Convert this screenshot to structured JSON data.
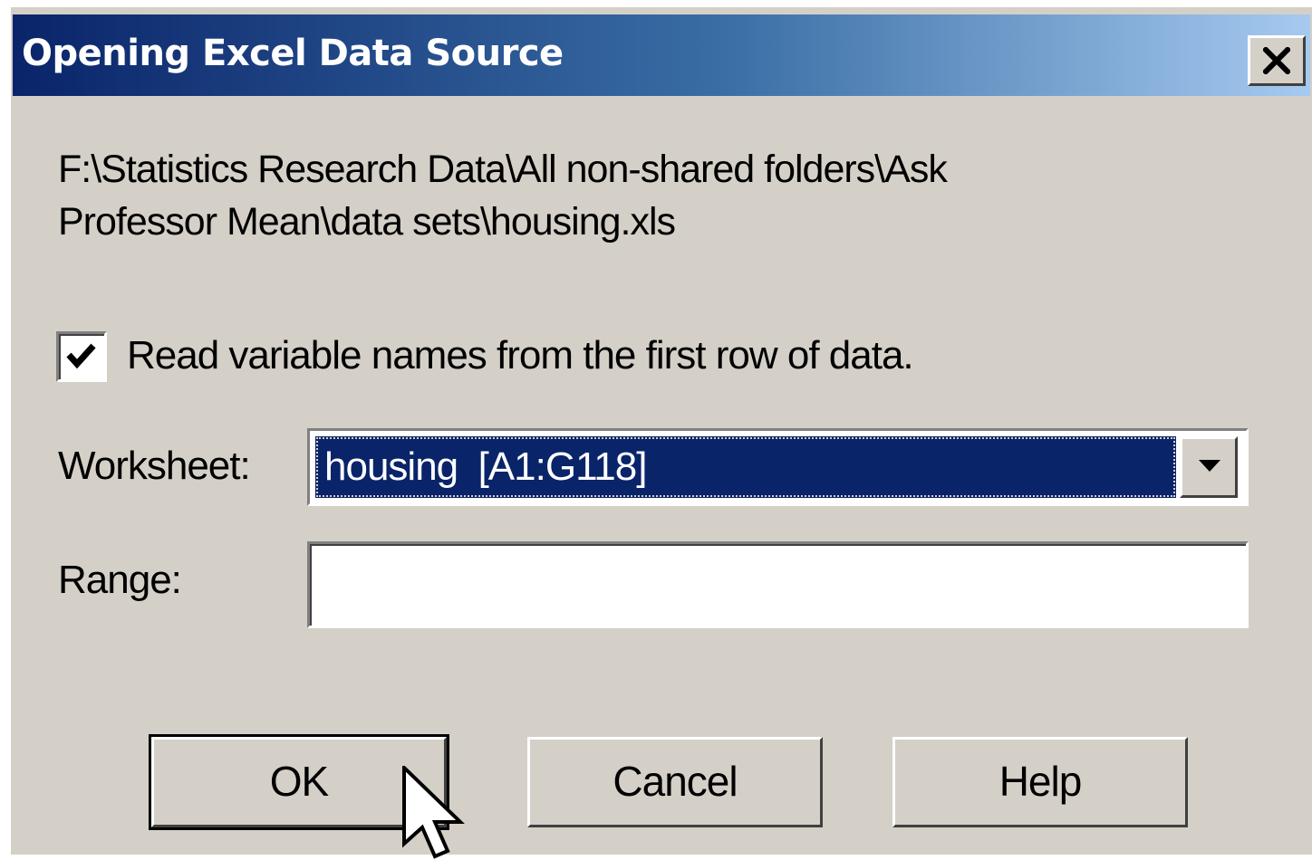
{
  "dialog": {
    "title": "Opening Excel Data Source",
    "close_label": "X",
    "file_path_line1": "F:\\Statistics Research Data\\All non-shared folders\\Ask",
    "file_path_line2": "Professor Mean\\data sets\\housing.xls",
    "read_names_checkbox": {
      "label": "Read variable names from the first row of data.",
      "checked": true
    },
    "worksheet": {
      "label": "Worksheet:",
      "selected": "housing  [A1:G118]"
    },
    "range": {
      "label": "Range:",
      "value": ""
    },
    "buttons": {
      "ok": "OK",
      "cancel": "Cancel",
      "help": "Help"
    }
  },
  "colors": {
    "titlebar_start": "#0a246a",
    "titlebar_end": "#a6caf0",
    "face": "#d4d0c8",
    "selection": "#0a246a"
  },
  "icons": {
    "close": "close-icon",
    "checkmark": "checkmark-icon",
    "dropdown": "chevron-down-icon",
    "cursor": "mouse-pointer-icon"
  }
}
